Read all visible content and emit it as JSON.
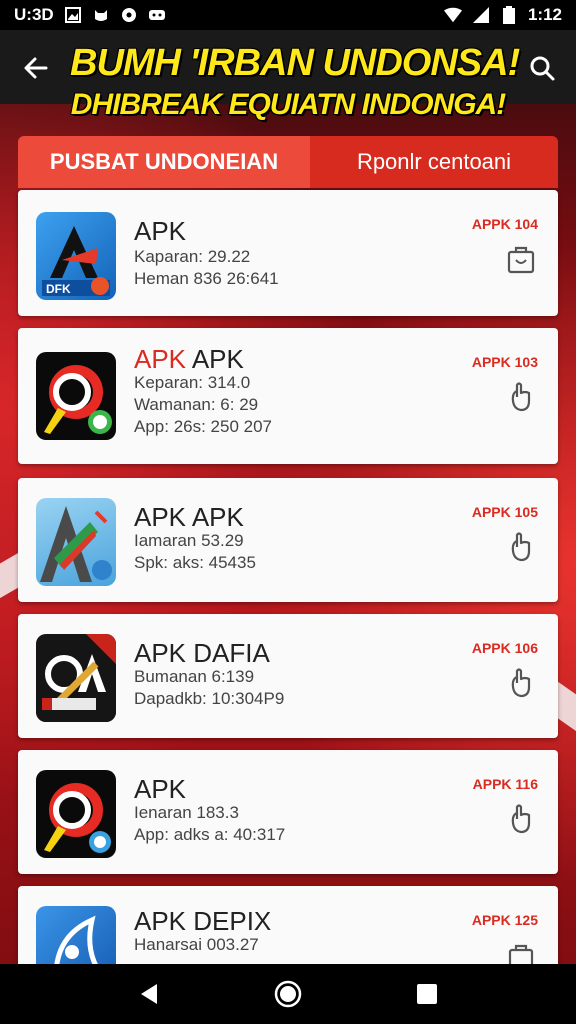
{
  "status": {
    "time_left": "U:3D",
    "time_right": "1:12",
    "icons": [
      "gallery-icon",
      "cat-icon",
      "circle-icon",
      "message-icon",
      "wifi-icon",
      "signal-icon",
      "battery-icon"
    ]
  },
  "header": {
    "title_line1": "BUMH 'IRBAN UNDONSA!",
    "title_line2": "DHIBREAK EQUIATN INDONGA!",
    "back_icon": "arrow-left-icon",
    "search_icon": "search-icon"
  },
  "tabs": [
    {
      "label": "PUSBAT UNDONEIAN",
      "active": true
    },
    {
      "label": "Rponlr centoani",
      "active": false
    }
  ],
  "apps": [
    {
      "name_red": "",
      "name": "APK",
      "meta": [
        "Kaparan: 29.22",
        "Heman 836 26:641"
      ],
      "badge": "APPK 104",
      "icon": "apk-a-blue-icon",
      "bg": "#1e7fd6"
    },
    {
      "name_red": "APK",
      "name": " APK",
      "meta": [
        "Keparan: 314.0",
        "Wamanan: 6: 29",
        "App: 26s: 250 207"
      ],
      "badge": "APPK 103",
      "icon": "apk-red-swirl-icon",
      "bg": "#0a0a0a"
    },
    {
      "name_red": "",
      "name": "APK APK",
      "meta": [
        "Iamaran 53.29",
        "Spk: aks: 45435"
      ],
      "badge": "APPK 105",
      "icon": "apk-a-flag-icon",
      "bg": "#7ec4ee"
    },
    {
      "name_red": "",
      "name": "APK  DAFIA",
      "meta": [
        "Bumanan 6:139",
        "Dapadkb: 10:304P9"
      ],
      "badge": "APPK 106",
      "icon": "apk-oa-gold-icon",
      "bg": "#111111"
    },
    {
      "name_red": "",
      "name": "APK",
      "meta": [
        "Ienaran 183.3",
        "App: adks a: 40:317"
      ],
      "badge": "APPK 116",
      "icon": "apk-red-swirl-icon",
      "bg": "#0a0a0a"
    },
    {
      "name_red": "",
      "name": "APK DEPIX",
      "meta": [
        "Hanarsai 003.27"
      ],
      "badge": "APPK 125",
      "icon": "apk-blue-feather-icon",
      "bg": "#1f78d1"
    }
  ],
  "navbar": {
    "back": "nav-back-icon",
    "home": "nav-home-icon",
    "recents": "nav-recents-icon"
  }
}
